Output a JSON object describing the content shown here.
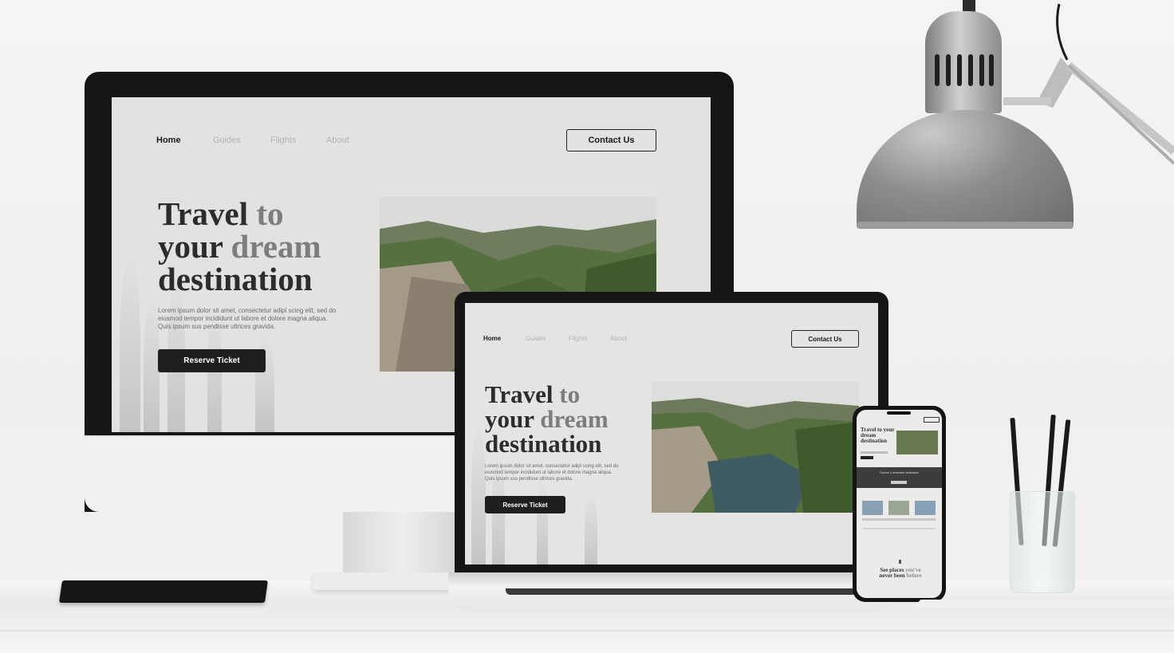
{
  "nav": {
    "home": "Home",
    "guides": "Guides",
    "flights": "Flights",
    "about": "About",
    "contact": "Contact Us"
  },
  "hero": {
    "title_line1_dark": "Travel ",
    "title_line1_light": "to",
    "title_line2_dark": "your ",
    "title_line2_light": "dream",
    "title_line3": "destination",
    "body": "Lorem ipsum dolor sit amet, consectetur adipi scing elit, sed do eiusmod tempor incididunt ut labore et dolore magna aliqua. Quis ipsum sus pendisse ultrices gravida.",
    "cta": "Reserve Ticket"
  },
  "phone": {
    "title": "Travel to your dream destination",
    "cta": "Reserve",
    "banner": "Explore & remember destination",
    "footer_line1": "See places ",
    "footer_line1_light": "you've",
    "footer_line2": "never been",
    "footer_line2_light": " before"
  },
  "colors": {
    "screen_bg": "#e3e2e0",
    "dark": "#1f1f1f",
    "muted_nav": "#b3b3b3"
  }
}
